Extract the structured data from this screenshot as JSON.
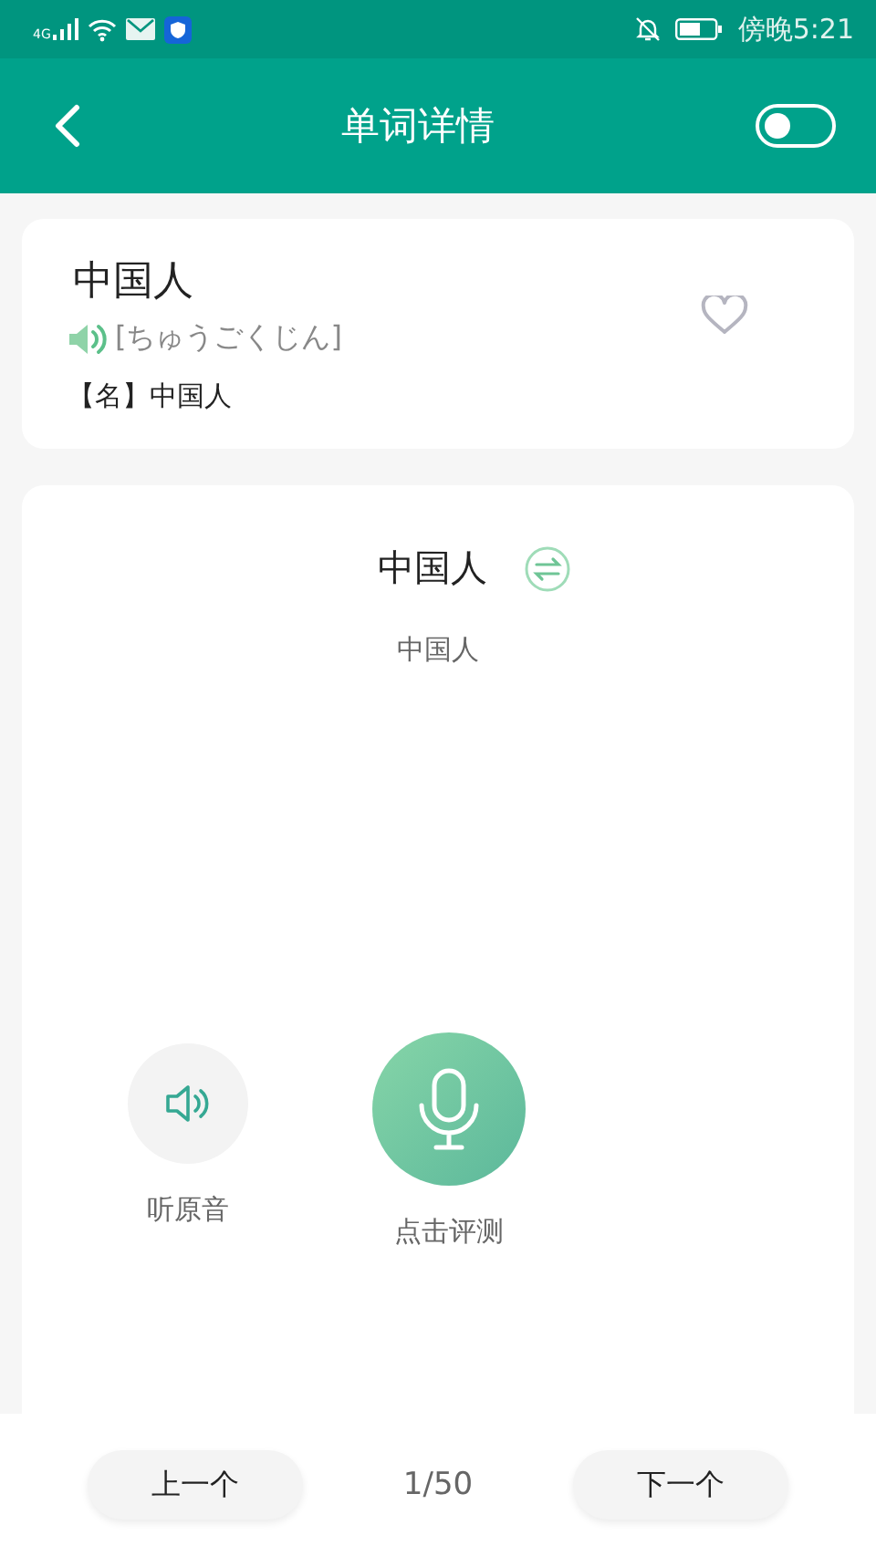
{
  "status_bar": {
    "network": "4G",
    "time": "傍晚5:21"
  },
  "app_bar": {
    "title": "单词详情",
    "toggle_on": false
  },
  "word_card": {
    "word": "中国人",
    "reading": "[ちゅうごくじん]",
    "meaning": "【名】中国人",
    "favorited": false
  },
  "practice": {
    "sentence": "中国人",
    "translation": "中国人",
    "listen_label": "听原音",
    "record_label": "点击评测"
  },
  "pager": {
    "prev": "上一个",
    "position": "1/50",
    "next": "下一个"
  }
}
